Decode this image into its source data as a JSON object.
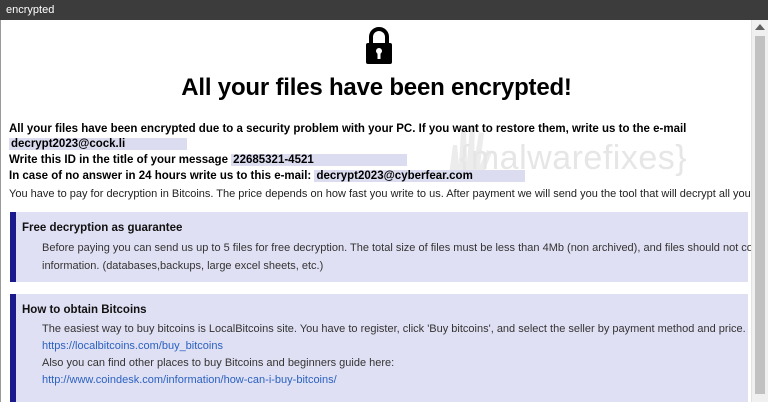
{
  "window": {
    "title": "encrypted"
  },
  "watermark": "{malwarefixes}",
  "page": {
    "heading": "All your files have been encrypted!",
    "intro": "All your files have been encrypted due to a security problem with your PC. If you want to restore them, write us to the e-mail",
    "email_primary": "decrypt2023@cock.li",
    "id_label": "Write this ID in the title of your message",
    "id_value": "22685321-4521",
    "fallback_label": "In case of no answer in 24 hours write us to this e-mail:",
    "email_fallback": "decrypt2023@cyberfear.com",
    "payment_note": "You have to pay for decryption in Bitcoins. The price depends on how fast you write to us. After payment we will send you the tool that will decrypt all your files."
  },
  "free_box": {
    "title": "Free decryption as guarantee",
    "line1": "Before paying you can send us up to 5 files for free decryption. The total size of files must be less than 4Mb (non archived), and files should not contain valuable",
    "line2": "information. (databases,backups, large excel sheets, etc.)"
  },
  "bitcoin_box": {
    "title": "How to obtain Bitcoins",
    "line1": "The easiest way to buy bitcoins is LocalBitcoins site. You have to register, click 'Buy bitcoins', and select the seller by payment method and price.",
    "link1": "https://localbitcoins.com/buy_bitcoins",
    "line2": "Also you can find other places to buy Bitcoins and beginners guide here:",
    "link2": "http://www.coindesk.com/information/how-can-i-buy-bitcoins/"
  },
  "colors": {
    "highlight": "#dcdcf0",
    "box_bg": "#e0e0f4",
    "box_border": "#1a1a8c",
    "link": "#2a62c0"
  }
}
